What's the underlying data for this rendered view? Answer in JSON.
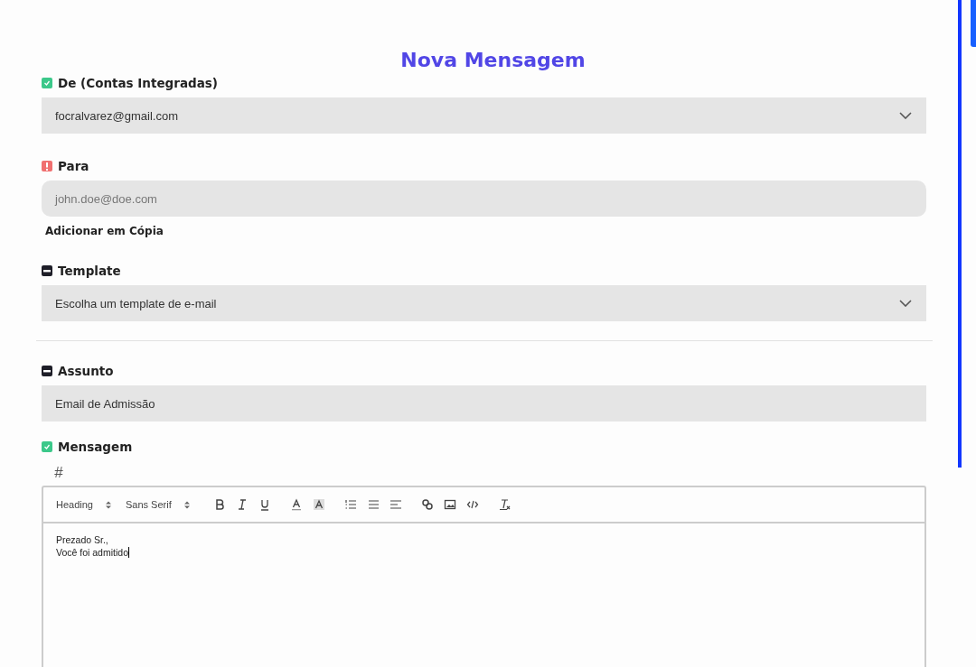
{
  "title": "Nova Mensagem",
  "fields": [
    {
      "kind": "select",
      "checked": true,
      "label": "De (Contas Integradas)",
      "value": "focralvarez@gmail.com"
    },
    {
      "kind": "input",
      "error": true,
      "rounded": true,
      "label": "Para",
      "placeholder": "john.doe@doe.com",
      "link": "Adicionar em Cópia"
    },
    {
      "kind": "select",
      "indeterminate": true,
      "label": "Template",
      "value": "Escolha um template de e-mail",
      "divider_after": true
    },
    {
      "kind": "input",
      "indeterminate": true,
      "rounded": false,
      "label": "Assunto",
      "value": "Email de Admissão"
    },
    {
      "kind": "editor",
      "checked": true,
      "label": "Mensagem",
      "hint": "#",
      "toolbar": {
        "heading": "Heading",
        "font": "Sans Serif"
      },
      "lines": [
        "Prezado Sr.,",
        "Você foi admitido"
      ]
    }
  ]
}
